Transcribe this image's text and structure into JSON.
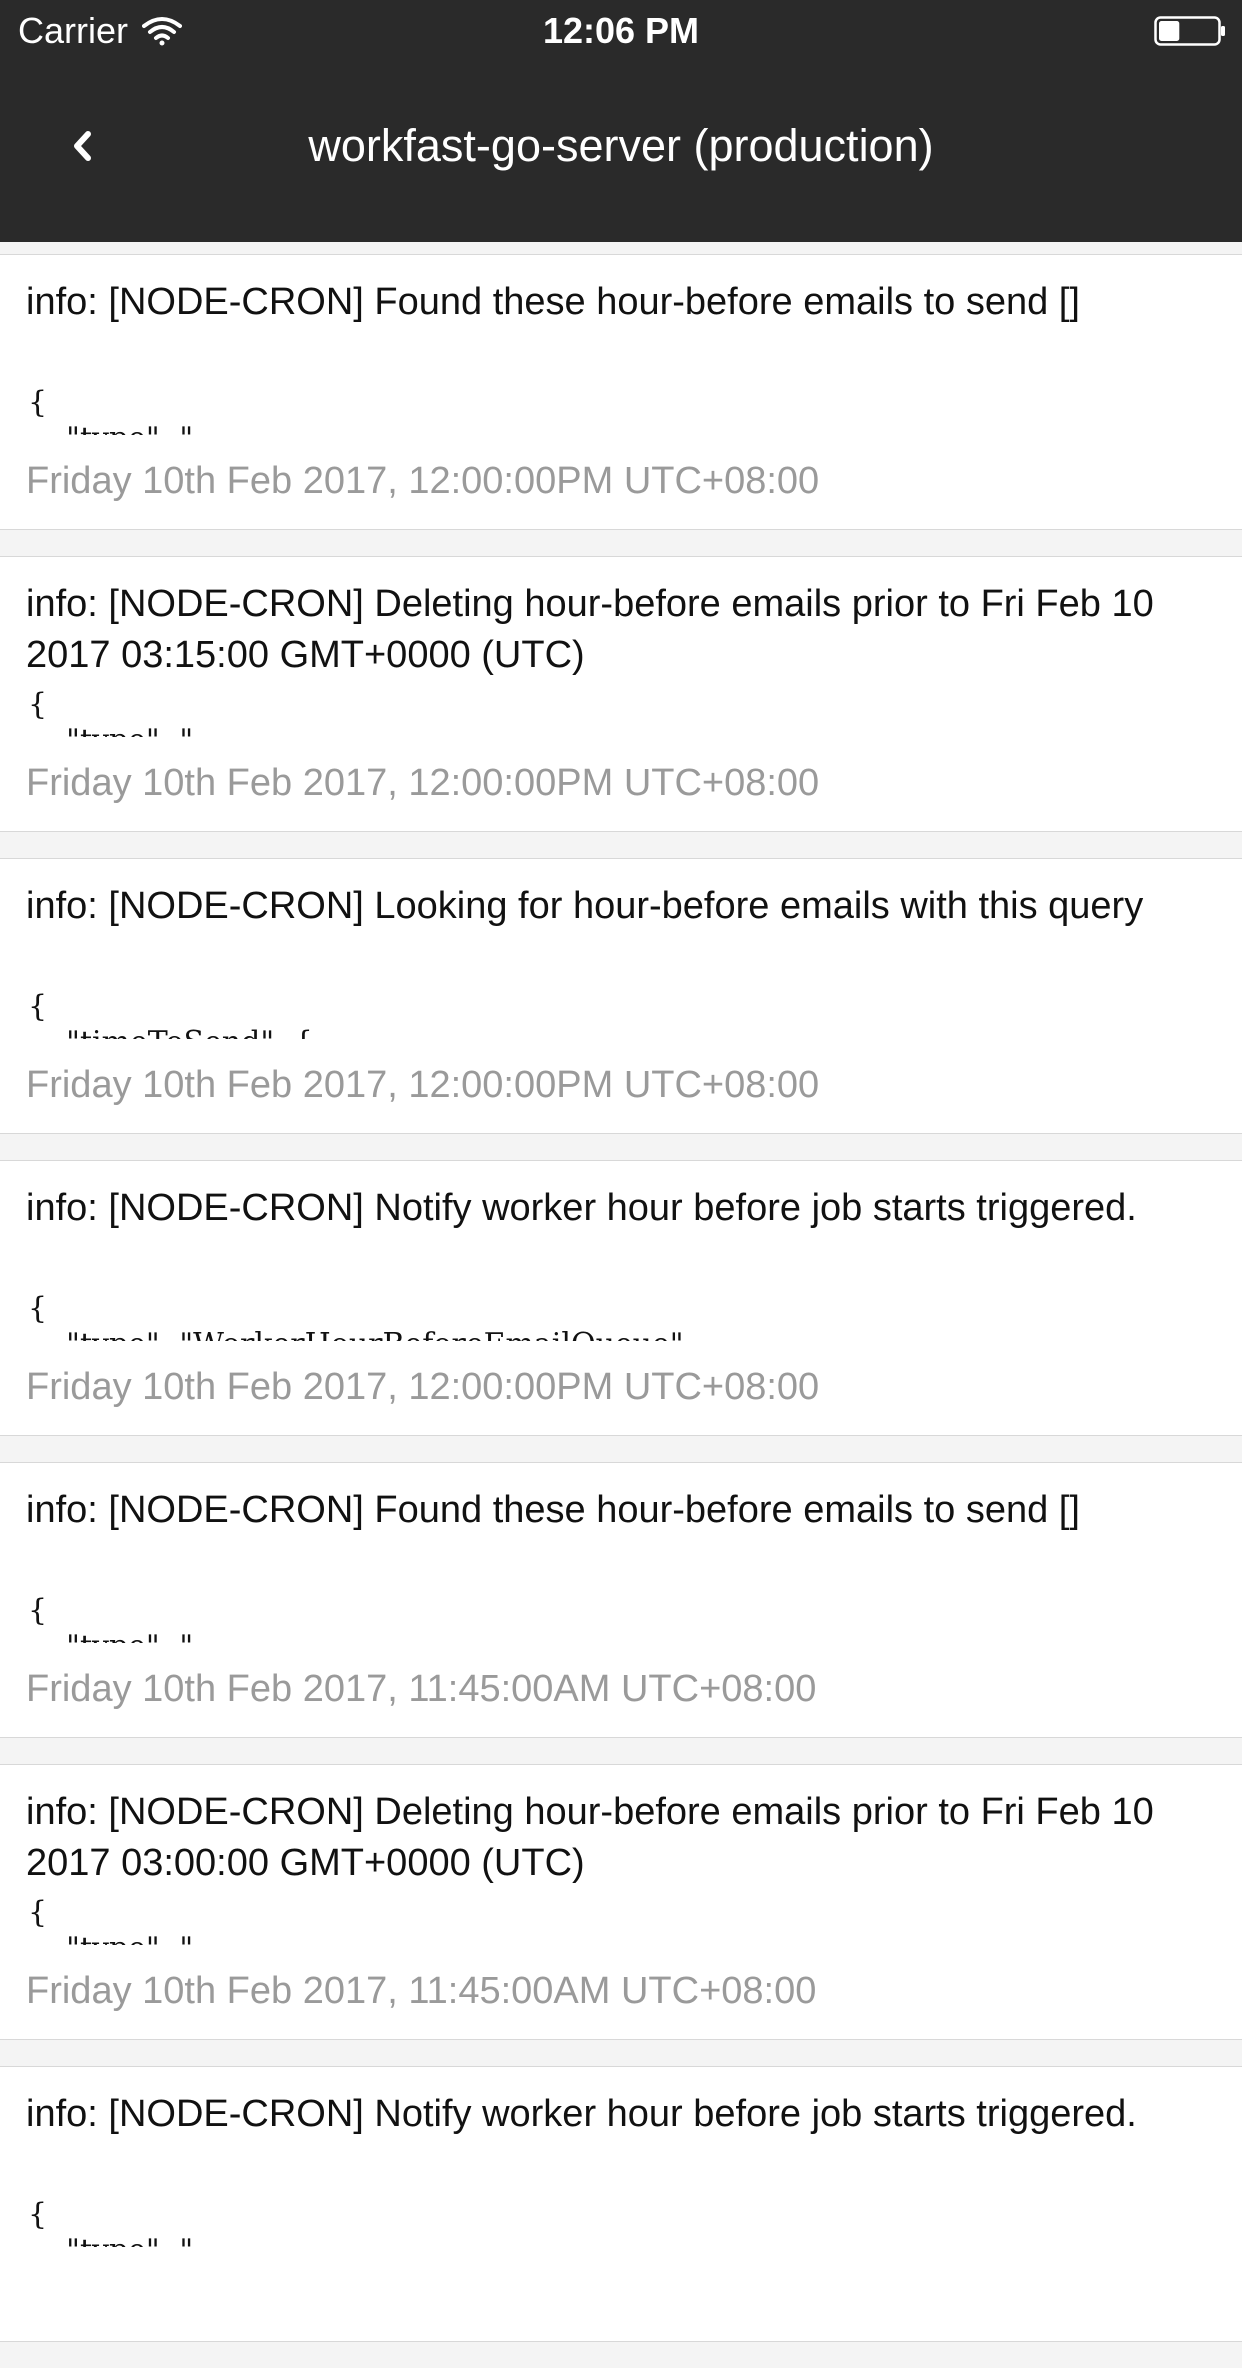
{
  "status_bar": {
    "carrier": "Carrier",
    "time": "12:06 PM",
    "wifi_icon": "wifi-icon",
    "battery_icon": "battery-icon",
    "battery_level": 0.35
  },
  "nav": {
    "title": "workfast-go-server (production)",
    "back_icon": "chevron-left-icon"
  },
  "logs": [
    {
      "message": "info: [NODE-CRON] Found these hour-before emails to send []",
      "json_preview": "{\n    \"type\": \"",
      "timestamp": "Friday 10th Feb 2017, 12:00:00PM UTC+08:00"
    },
    {
      "message": "info: [NODE-CRON] Deleting hour-before emails prior to Fri Feb 10 2017 03:15:00 GMT+0000 (UTC)",
      "json_preview": "{\n    \"type\": \"",
      "timestamp": "Friday 10th Feb 2017, 12:00:00PM UTC+08:00"
    },
    {
      "message": "info: [NODE-CRON] Looking for hour-before emails with this query",
      "json_preview": "{\n    \"timeToSend\": {",
      "timestamp": "Friday 10th Feb 2017, 12:00:00PM UTC+08:00"
    },
    {
      "message": "info: [NODE-CRON] Notify worker hour before job starts triggered.",
      "json_preview": "{\n    \"type\": \"WorkerHourBeforeEmailQueue\"",
      "timestamp": "Friday 10th Feb 2017, 12:00:00PM UTC+08:00"
    },
    {
      "message": "info: [NODE-CRON] Found these hour-before emails to send []",
      "json_preview": "{\n    \"type\": \"",
      "timestamp": "Friday 10th Feb 2017, 11:45:00AM UTC+08:00"
    },
    {
      "message": "info: [NODE-CRON] Deleting hour-before emails prior to Fri Feb 10 2017 03:00:00 GMT+0000 (UTC)",
      "json_preview": "{\n    \"type\": \"",
      "timestamp": "Friday 10th Feb 2017, 11:45:00AM UTC+08:00"
    },
    {
      "message": "info: [NODE-CRON] Notify worker hour before job starts triggered.",
      "json_preview": "{\n    \"type\": \"",
      "timestamp": ""
    }
  ]
}
